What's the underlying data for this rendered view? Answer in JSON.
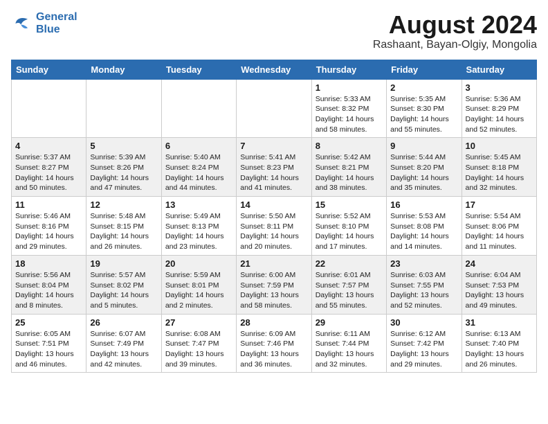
{
  "header": {
    "logo_line1": "General",
    "logo_line2": "Blue",
    "month": "August 2024",
    "location": "Rashaant, Bayan-Olgiy, Mongolia"
  },
  "weekdays": [
    "Sunday",
    "Monday",
    "Tuesday",
    "Wednesday",
    "Thursday",
    "Friday",
    "Saturday"
  ],
  "weeks": [
    [
      {
        "day": "",
        "info": ""
      },
      {
        "day": "",
        "info": ""
      },
      {
        "day": "",
        "info": ""
      },
      {
        "day": "",
        "info": ""
      },
      {
        "day": "1",
        "info": "Sunrise: 5:33 AM\nSunset: 8:32 PM\nDaylight: 14 hours\nand 58 minutes."
      },
      {
        "day": "2",
        "info": "Sunrise: 5:35 AM\nSunset: 8:30 PM\nDaylight: 14 hours\nand 55 minutes."
      },
      {
        "day": "3",
        "info": "Sunrise: 5:36 AM\nSunset: 8:29 PM\nDaylight: 14 hours\nand 52 minutes."
      }
    ],
    [
      {
        "day": "4",
        "info": "Sunrise: 5:37 AM\nSunset: 8:27 PM\nDaylight: 14 hours\nand 50 minutes."
      },
      {
        "day": "5",
        "info": "Sunrise: 5:39 AM\nSunset: 8:26 PM\nDaylight: 14 hours\nand 47 minutes."
      },
      {
        "day": "6",
        "info": "Sunrise: 5:40 AM\nSunset: 8:24 PM\nDaylight: 14 hours\nand 44 minutes."
      },
      {
        "day": "7",
        "info": "Sunrise: 5:41 AM\nSunset: 8:23 PM\nDaylight: 14 hours\nand 41 minutes."
      },
      {
        "day": "8",
        "info": "Sunrise: 5:42 AM\nSunset: 8:21 PM\nDaylight: 14 hours\nand 38 minutes."
      },
      {
        "day": "9",
        "info": "Sunrise: 5:44 AM\nSunset: 8:20 PM\nDaylight: 14 hours\nand 35 minutes."
      },
      {
        "day": "10",
        "info": "Sunrise: 5:45 AM\nSunset: 8:18 PM\nDaylight: 14 hours\nand 32 minutes."
      }
    ],
    [
      {
        "day": "11",
        "info": "Sunrise: 5:46 AM\nSunset: 8:16 PM\nDaylight: 14 hours\nand 29 minutes."
      },
      {
        "day": "12",
        "info": "Sunrise: 5:48 AM\nSunset: 8:15 PM\nDaylight: 14 hours\nand 26 minutes."
      },
      {
        "day": "13",
        "info": "Sunrise: 5:49 AM\nSunset: 8:13 PM\nDaylight: 14 hours\nand 23 minutes."
      },
      {
        "day": "14",
        "info": "Sunrise: 5:50 AM\nSunset: 8:11 PM\nDaylight: 14 hours\nand 20 minutes."
      },
      {
        "day": "15",
        "info": "Sunrise: 5:52 AM\nSunset: 8:10 PM\nDaylight: 14 hours\nand 17 minutes."
      },
      {
        "day": "16",
        "info": "Sunrise: 5:53 AM\nSunset: 8:08 PM\nDaylight: 14 hours\nand 14 minutes."
      },
      {
        "day": "17",
        "info": "Sunrise: 5:54 AM\nSunset: 8:06 PM\nDaylight: 14 hours\nand 11 minutes."
      }
    ],
    [
      {
        "day": "18",
        "info": "Sunrise: 5:56 AM\nSunset: 8:04 PM\nDaylight: 14 hours\nand 8 minutes."
      },
      {
        "day": "19",
        "info": "Sunrise: 5:57 AM\nSunset: 8:02 PM\nDaylight: 14 hours\nand 5 minutes."
      },
      {
        "day": "20",
        "info": "Sunrise: 5:59 AM\nSunset: 8:01 PM\nDaylight: 14 hours\nand 2 minutes."
      },
      {
        "day": "21",
        "info": "Sunrise: 6:00 AM\nSunset: 7:59 PM\nDaylight: 13 hours\nand 58 minutes."
      },
      {
        "day": "22",
        "info": "Sunrise: 6:01 AM\nSunset: 7:57 PM\nDaylight: 13 hours\nand 55 minutes."
      },
      {
        "day": "23",
        "info": "Sunrise: 6:03 AM\nSunset: 7:55 PM\nDaylight: 13 hours\nand 52 minutes."
      },
      {
        "day": "24",
        "info": "Sunrise: 6:04 AM\nSunset: 7:53 PM\nDaylight: 13 hours\nand 49 minutes."
      }
    ],
    [
      {
        "day": "25",
        "info": "Sunrise: 6:05 AM\nSunset: 7:51 PM\nDaylight: 13 hours\nand 46 minutes."
      },
      {
        "day": "26",
        "info": "Sunrise: 6:07 AM\nSunset: 7:49 PM\nDaylight: 13 hours\nand 42 minutes."
      },
      {
        "day": "27",
        "info": "Sunrise: 6:08 AM\nSunset: 7:47 PM\nDaylight: 13 hours\nand 39 minutes."
      },
      {
        "day": "28",
        "info": "Sunrise: 6:09 AM\nSunset: 7:46 PM\nDaylight: 13 hours\nand 36 minutes."
      },
      {
        "day": "29",
        "info": "Sunrise: 6:11 AM\nSunset: 7:44 PM\nDaylight: 13 hours\nand 32 minutes."
      },
      {
        "day": "30",
        "info": "Sunrise: 6:12 AM\nSunset: 7:42 PM\nDaylight: 13 hours\nand 29 minutes."
      },
      {
        "day": "31",
        "info": "Sunrise: 6:13 AM\nSunset: 7:40 PM\nDaylight: 13 hours\nand 26 minutes."
      }
    ]
  ]
}
